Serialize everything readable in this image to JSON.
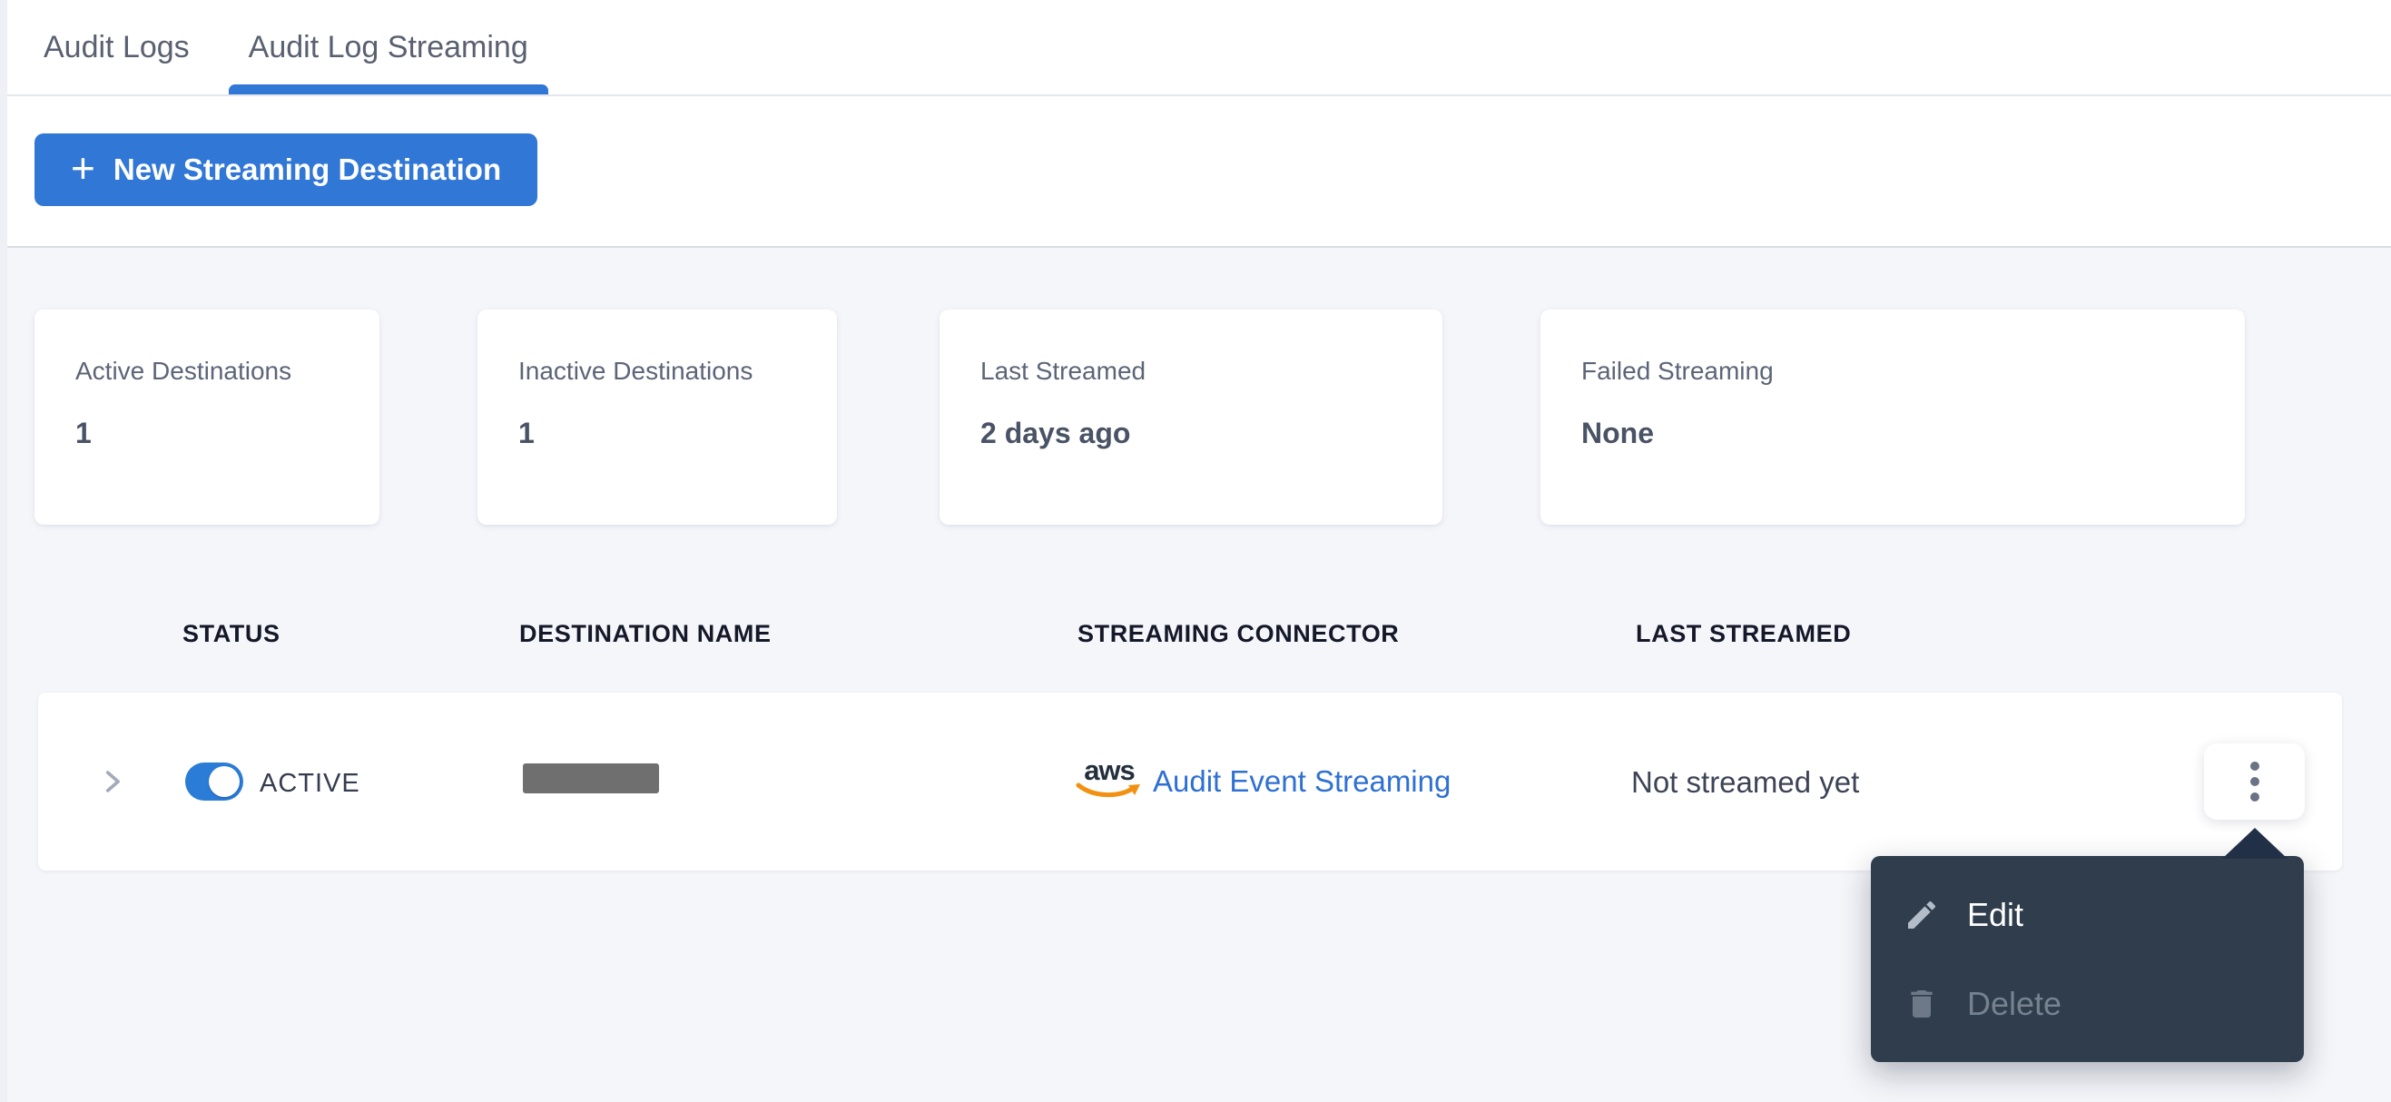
{
  "tabs": [
    {
      "label": "Audit Logs",
      "active": false
    },
    {
      "label": "Audit Log Streaming",
      "active": true
    }
  ],
  "toolbar": {
    "plus_glyph": "+",
    "new_destination_label": "New Streaming Destination"
  },
  "stats_cards": [
    {
      "label": "Active Destinations",
      "value": "1"
    },
    {
      "label": "Inactive Destinations",
      "value": "1"
    },
    {
      "label": "Last Streamed",
      "value": "2 days ago"
    },
    {
      "label": "Failed Streaming",
      "value": "None"
    }
  ],
  "table": {
    "columns": [
      "STATUS",
      "DESTINATION NAME",
      "STREAMING CONNECTOR",
      "LAST STREAMED"
    ],
    "row": {
      "status_label": "ACTIVE",
      "status_on": true,
      "destination_name_redacted": true,
      "connector": {
        "provider_wordmark": "aws",
        "label": "Audit Event Streaming"
      },
      "last_streamed": "Not streamed yet"
    }
  },
  "context_menu": {
    "items": [
      {
        "label": "Edit",
        "icon": "pencil-icon",
        "enabled": true
      },
      {
        "label": "Delete",
        "icon": "trash-icon",
        "enabled": false
      }
    ]
  },
  "colors": {
    "accent_blue": "#3177d6",
    "toggle_on": "#2a7cd7",
    "link_blue": "#2e70d3",
    "menu_bg": "#2f3d4c",
    "arrow_navy": "#223047",
    "aws_orange": "#f29111"
  }
}
